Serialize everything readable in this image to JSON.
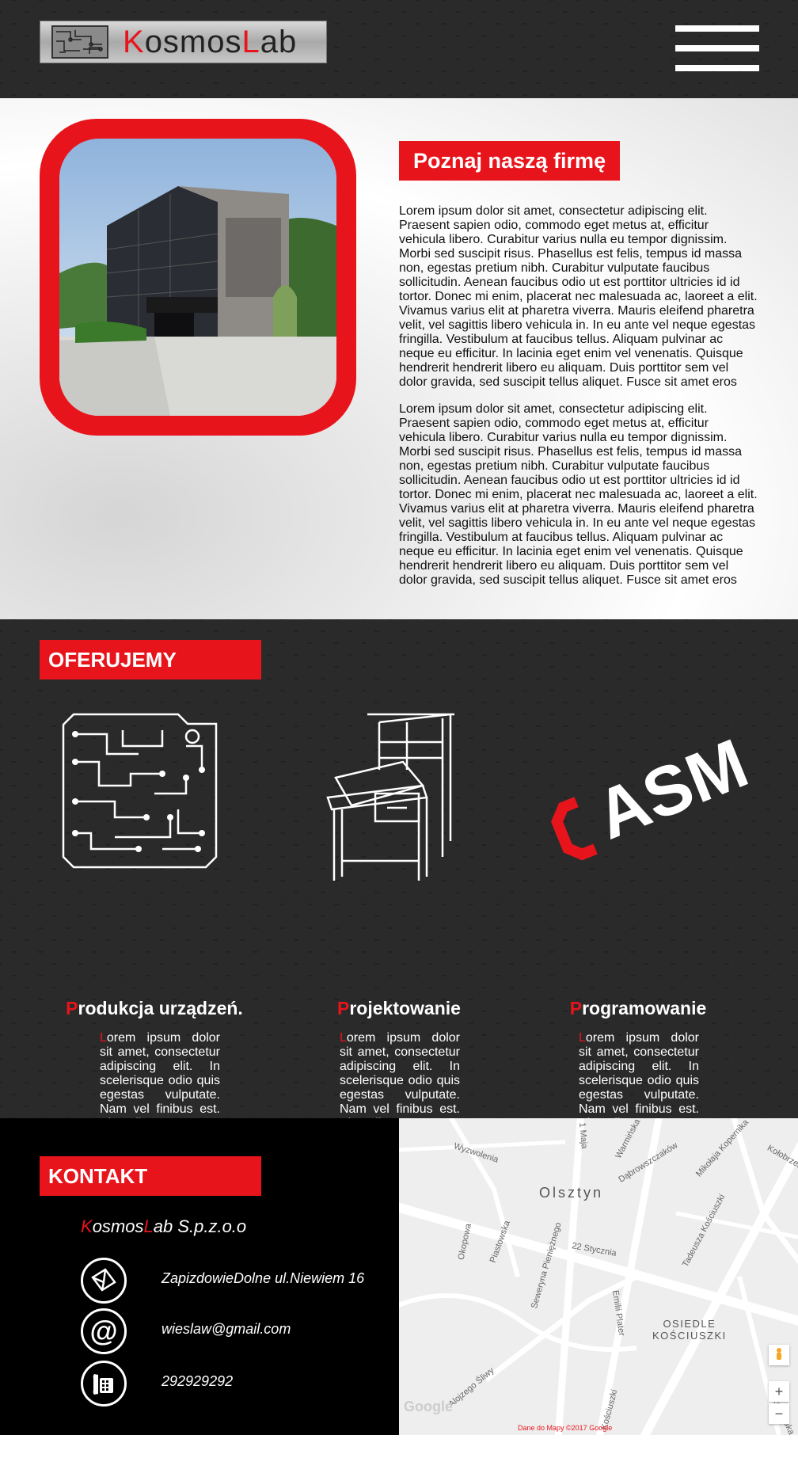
{
  "header": {
    "logo_k": "K",
    "logo_mid": "osmos",
    "logo_l": "L",
    "logo_end": "ab",
    "menu_icon": "hamburger-icon"
  },
  "about": {
    "title": "Poznaj naszą firmę",
    "p1": "Lorem ipsum dolor sit amet, consectetur adipiscing elit. Praesent sapien odio, commodo eget metus at, efficitur vehicula libero. Curabitur varius nulla eu tempor dignissim. Morbi sed suscipit risus. Phasellus est felis, tempus id massa non, egestas pretium nibh. Curabitur vulputate faucibus sollicitudin. Aenean faucibus odio ut est porttitor ultricies id id tortor. Donec mi enim, placerat nec malesuada ac, laoreet a elit. Vivamus varius elit at pharetra viverra. Mauris eleifend pharetra velit, vel sagittis libero vehicula in. In eu ante vel neque egestas fringilla. Vestibulum at faucibus tellus. Aliquam pulvinar ac neque eu efficitur. In lacinia eget enim vel venenatis. Quisque hendrerit hendrerit libero eu aliquam. Duis porttitor sem vel dolor gravida, sed suscipit tellus aliquet. Fusce sit amet eros",
    "p2": "Lorem ipsum dolor sit amet, consectetur adipiscing elit. Praesent sapien odio, commodo eget metus at, efficitur vehicula libero. Curabitur varius nulla eu tempor dignissim. Morbi sed suscipit risus. Phasellus est felis, tempus id massa non, egestas pretium nibh. Curabitur vulputate faucibus sollicitudin. Aenean faucibus odio ut est porttitor ultricies id id tortor. Donec mi enim, placerat nec malesuada ac, laoreet a elit. Vivamus varius elit at pharetra viverra. Mauris eleifend pharetra velit, vel sagittis libero vehicula in. In eu ante vel neque egestas fringilla. Vestibulum at faucibus tellus. Aliquam pulvinar ac neque eu efficitur. In lacinia eget enim vel venenatis. Quisque hendrerit hendrerit libero eu aliquam. Duis porttitor sem vel dolor gravida, sed suscipit tellus aliquet. Fusce sit amet eros"
  },
  "offer": {
    "title": "OFERUJEMY",
    "services": [
      {
        "cap": "P",
        "rest": "rodukcja urządzeń.",
        "icon": "circuit-board-icon"
      },
      {
        "cap": "P",
        "rest": "rojektowanie",
        "icon": "drafting-desk-icon"
      },
      {
        "cap": "P",
        "rest": "rogramowanie",
        "icon": "asm-logo-icon"
      }
    ],
    "text_cap": "L",
    "text_rest": "orem ipsum dolor sit amet, consectetur adipiscing elit. In scelerisque odio quis egestas vulputate. Nam vel finibus est. Phasellus tortor turpis, porta at velit et."
  },
  "contact": {
    "title": "KONTAKT",
    "company_k": "K",
    "company_mid": "osmos",
    "company_l": "L",
    "company_end": "ab S.p.z.o.o",
    "address": "ZapizdowieDolne ul.Niewiem 16",
    "email": "wieslaw@gmail.com",
    "phone": "292929292"
  },
  "map": {
    "city": "Olsztyn",
    "district_1": "OSIEDLE",
    "district_2": "KOŚCIUSZKI",
    "streets": [
      "Wyzwolenia",
      "1 Maja",
      "Warmińska",
      "Dąbrowszczaków",
      "Mikołaja Kopernika",
      "Kołobrzeska",
      "Tadeusza Kościuszki",
      "Okopowa",
      "Piastowska",
      "Seweryna Pieniężnego",
      "22 Stycznia",
      "Emilii Plater",
      "Alojzego Śliwy",
      "Kościuszki",
      "Żołnierska"
    ],
    "google": "Google",
    "credit": "Dane do Mapy ©2017 Google",
    "zoom_in": "+",
    "zoom_out": "−"
  },
  "colors": {
    "accent": "#e8141c",
    "dark": "#1a1a1a",
    "text": "#111111"
  }
}
